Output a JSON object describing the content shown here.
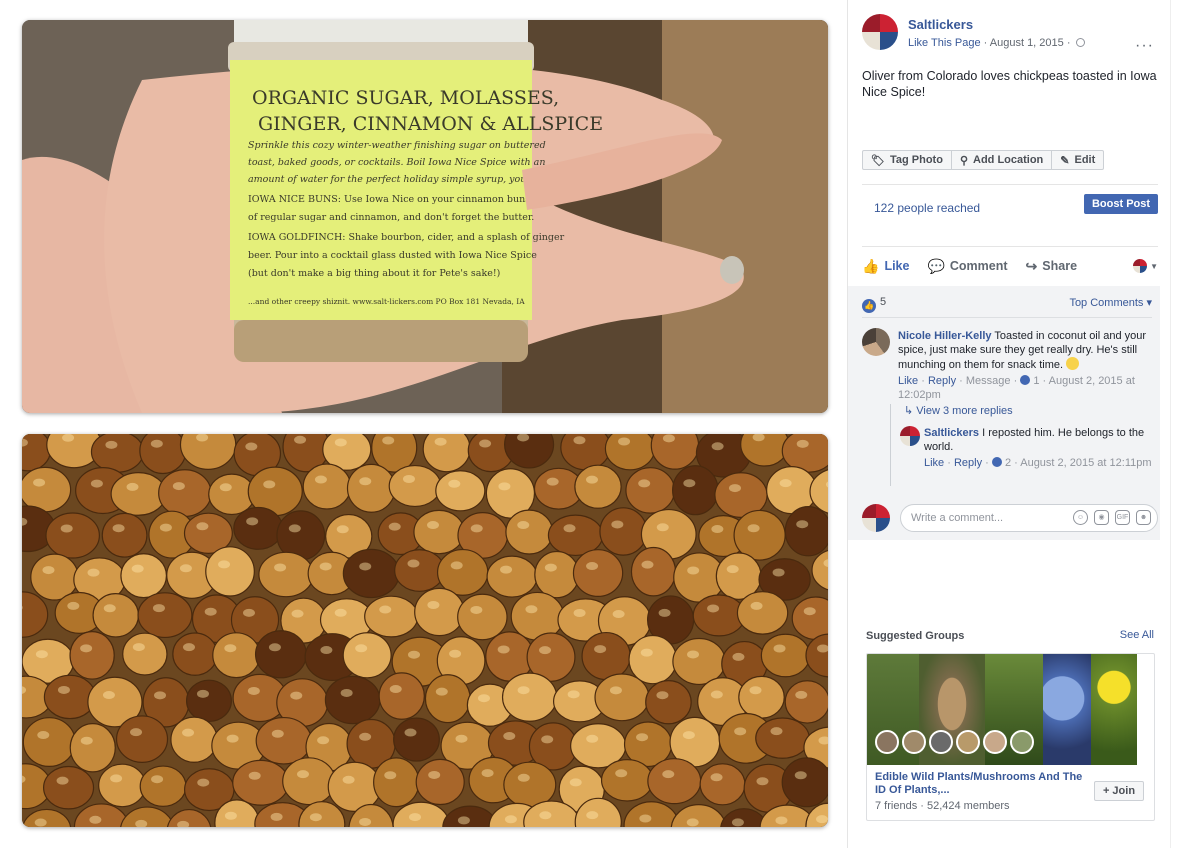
{
  "post": {
    "page_name": "Saltlickers",
    "like_this_page": "Like This Page",
    "date": "August 1, 2015",
    "text": "Oliver from Colorado loves chickpeas toasted in Iowa Nice Spice!",
    "tag_photo": "Tag Photo",
    "add_location": "Add Location",
    "edit": "Edit",
    "reached": "122 people reached",
    "boost": "Boost Post",
    "like": "Like",
    "comment": "Comment",
    "share": "Share"
  },
  "photo": {
    "jar_line1": "ORGANIC SUGAR, MOLASSES,",
    "jar_line2": "GINGER, CINNAMON & ALLSPICE",
    "jar_line3": "Sprinkle this cozy winter-weather finishing sugar on buttered",
    "jar_line4": "toast, baked goods, or cocktails. Boil Iowa Nice Spice with an",
    "jar_line5": "amount of water for the perfect holiday simple syrup, you bet.",
    "jar_line6": "IOWA NICE BUNS: Use Iowa Nice on your cinnamon buns",
    "jar_line7": "of regular sugar and cinnamon, and don't forget the butter.",
    "jar_line8": "IOWA GOLDFINCH: Shake bourbon, cider, and a splash of ginger",
    "jar_line9": "beer. Pour into a cocktail glass dusted with Iowa Nice Spice",
    "jar_line10": "(but don't make a big thing about it for Pete's sake!)",
    "jar_line11": "...and other creepy shiznit.  www.salt-lickers.com  PO Box 181 Nevada, IA"
  },
  "reactions": {
    "count": "5",
    "top_comments": "Top Comments"
  },
  "comments": [
    {
      "name": "Nicole Hiller-Kelly",
      "text": "Toasted in coconut oil and your spice, just make sure they get really dry. He's still munching on them for snack time.",
      "like": "Like",
      "reply": "Reply",
      "message": "Message",
      "likes": "1",
      "time": "August 2, 2015 at 12:02pm"
    }
  ],
  "view_replies": "View 3 more replies",
  "reply": {
    "name": "Saltlickers",
    "text": "I reposted him. He belongs to the world.",
    "like": "Like",
    "reply": "Reply",
    "likes": "2",
    "time": "August 2, 2015 at 12:11pm"
  },
  "write_comment": {
    "placeholder": "Write a comment..."
  },
  "suggested": {
    "title": "Suggested Groups",
    "see_all": "See All",
    "group_name": "Edible Wild Plants/Mushrooms And The ID Of Plants,...",
    "group_meta": "7 friends · 52,424 members",
    "join": "+ Join"
  },
  "colors": {
    "link": "#385898",
    "primary": "#4267b2",
    "comment_bg": "#f2f3f5"
  }
}
